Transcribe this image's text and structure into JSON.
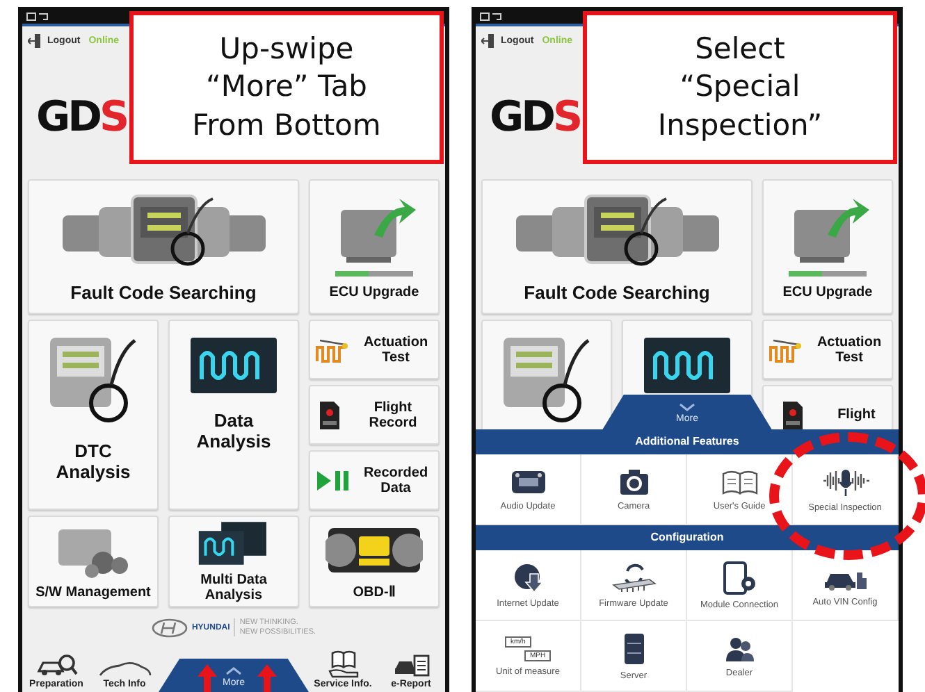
{
  "phones": [
    {
      "header": {
        "logout": "Logout",
        "connection": "Online"
      },
      "logo": "GDS",
      "callout": [
        "Up-swipe",
        "“More” Tab",
        "From Bottom"
      ],
      "tiles": [
        {
          "kind": "wide",
          "label": "Fault Code Searching"
        },
        {
          "kind": "square",
          "label": "ECU Upgrade"
        },
        {
          "kind": "tall",
          "label": "DTC Analysis"
        },
        {
          "kind": "tall",
          "label": "Data Analysis"
        },
        {
          "kind": "side",
          "label": "Actuation Test"
        },
        {
          "kind": "side",
          "label": "Flight Record"
        },
        {
          "kind": "side",
          "label": "Recorded Data"
        },
        {
          "kind": "square",
          "label": "S/W Management"
        },
        {
          "kind": "square",
          "label": "Multi Data Analysis"
        },
        {
          "kind": "square",
          "label": "OBD-Ⅱ"
        }
      ],
      "brand": {
        "name": "HYUNDAI",
        "slogan": [
          "NEW THINKING.",
          "NEW POSSIBILITIES."
        ]
      },
      "bottom_nav": [
        {
          "kind": "item",
          "label": "Preparation"
        },
        {
          "kind": "item",
          "label": "Tech Info"
        },
        {
          "kind": "more",
          "label": "More"
        },
        {
          "kind": "item",
          "label": "Service Info."
        },
        {
          "kind": "item",
          "label": "e-Report"
        }
      ],
      "marks": [
        {
          "kind": "arrow"
        },
        {
          "kind": "arrow"
        }
      ]
    },
    {
      "header": {
        "logout": "Logout",
        "connection": "Online"
      },
      "logo": "GDS",
      "callout": [
        "Select",
        "“Special",
        "Inspection”"
      ],
      "tiles": [
        {
          "kind": "wide",
          "label": "Fault Code Searching"
        },
        {
          "kind": "square",
          "label": "ECU Upgrade"
        },
        {
          "kind": "tall"
        },
        {
          "kind": "tall"
        },
        {
          "kind": "side",
          "label": "Actuation Test"
        },
        {
          "kind": "side",
          "label": "Flight"
        }
      ],
      "more_panel": {
        "tab": "More",
        "sections": [
          {
            "title": "Additional Features",
            "items": [
              {
                "label": "Audio Update"
              },
              {
                "label": "Camera"
              },
              {
                "label": "User's Guide"
              },
              {
                "label": "Special Inspection"
              }
            ]
          },
          {
            "title": "Configuration",
            "items": [
              {
                "label": "Internet Update"
              },
              {
                "label": "Firmware Update"
              },
              {
                "label": "Module Connection"
              },
              {
                "label": "Auto VIN Config"
              },
              {
                "label": "Unit of measure",
                "unit_labels": [
                  "km/h",
                  "MPH"
                ]
              },
              {
                "label": "Server"
              },
              {
                "label": "Dealer"
              }
            ]
          }
        ]
      },
      "marks": [
        {
          "kind": "ring"
        }
      ]
    }
  ]
}
